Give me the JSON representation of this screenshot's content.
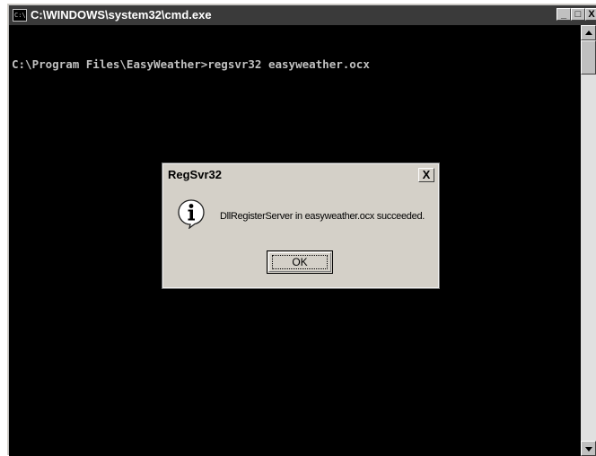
{
  "window": {
    "title": "C:\\WINDOWS\\system32\\cmd.exe",
    "icon": "console-icon",
    "minimize_glyph": "_",
    "maximize_glyph": "□",
    "close_glyph": "X"
  },
  "console": {
    "lines": [
      "C:\\Program Files\\EasyWeather>regsvr32 easyweather.ocx"
    ],
    "text_color": "#c0c0c0",
    "background": "#000000"
  },
  "dialog": {
    "title": "RegSvr32",
    "close_glyph": "X",
    "icon": "info-icon",
    "message": "DllRegisterServer in easyweather.ocx succeeded.",
    "ok_label": "OK"
  }
}
